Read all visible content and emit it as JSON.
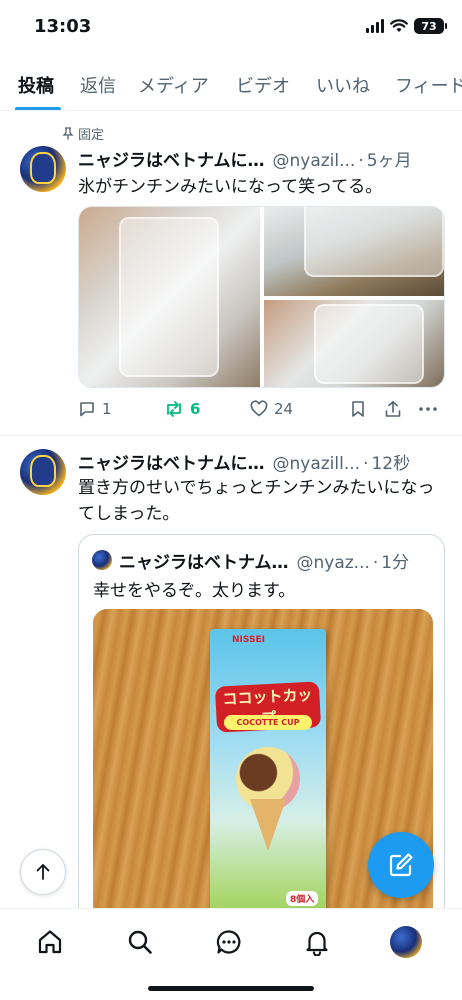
{
  "status_bar": {
    "time": "13:03",
    "battery": "73"
  },
  "tabs": [
    {
      "label": "投稿"
    },
    {
      "label": "返信"
    },
    {
      "label": "メディア"
    },
    {
      "label": "ビデオ"
    },
    {
      "label": "いいね"
    },
    {
      "label": "フィード"
    }
  ],
  "posts": [
    {
      "pinned_label": "固定",
      "name": "ニャジラはベトナムに…",
      "handle": "@nyazil...",
      "time": "5ヶ月",
      "text": "氷がチンチンみたいになって笑ってる。",
      "replies": "1",
      "reposts": "6",
      "likes": "24"
    },
    {
      "name": "ニャジラはベトナムに…",
      "handle": "@nyazill...",
      "time": "12秒",
      "text": "置き方のせいでちょっとチンチンみたいになってしまった。",
      "quote": {
        "name": "ニャジラはベトナム…",
        "handle": "@nyaz...",
        "time": "1分",
        "text": "幸せをやるぞ。太ります。",
        "product": {
          "brand": "NISSEI",
          "title": "ココットカップ",
          "subtitle": "COCOTTE CUP",
          "count": "8個入"
        }
      }
    }
  ],
  "colors": {
    "accent": "#1d9bf0",
    "repost": "#00ba7c",
    "text": "#0f1419",
    "muted": "#536471"
  }
}
